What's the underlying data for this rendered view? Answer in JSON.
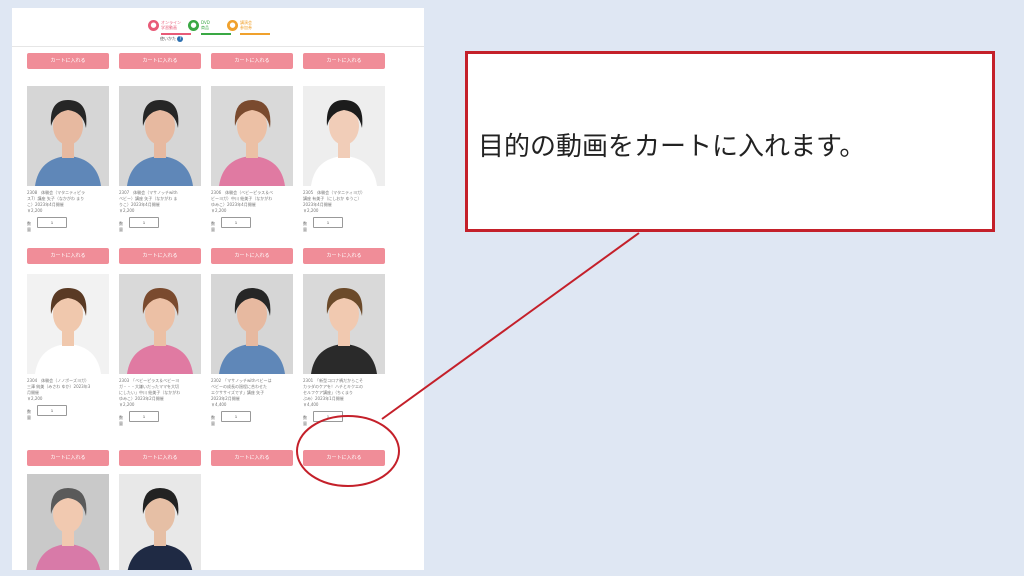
{
  "header": {
    "tabs": [
      {
        "label": "オンライン\n学習動画",
        "color": "#e85b78"
      },
      {
        "label": "DVD\n商品",
        "color": "#3aa844"
      },
      {
        "label": "講演会\n参加券",
        "color": "#f0a12d"
      }
    ],
    "sub_link": "使いかた",
    "help_icon": "?"
  },
  "cart_button_label": "カートに入れる",
  "qty_label": "数量",
  "qty_value": "1",
  "products": [
    {
      "caption": "2308　体験会（マタニティピラ\nス7）講座 矢子（なかがわ まり\nこ）2023年4月開催",
      "price": "￥2,200",
      "photo": {
        "bg": "#d6d6d6",
        "hair": "#262626",
        "skin": "#e7b9a0",
        "shirt": "#5f87b8"
      }
    },
    {
      "caption": "2307　体験会（マサノッチwith\nベビー）講座 矢子（なかがわ ま\nりこ）2023年4月開催",
      "price": "￥2,200",
      "photo": {
        "bg": "#d6d6d6",
        "hair": "#262626",
        "skin": "#e7b9a0",
        "shirt": "#5f87b8"
      }
    },
    {
      "caption": "2306　体験会（ベビーピラス＆ベ\nビーヨガ）中川 絵美子（なかがわ\nゆみこ）2023年4月開催",
      "price": "￥2,200",
      "photo": {
        "bg": "#d9d9d9",
        "hair": "#7a4a2e",
        "skin": "#ecc0a5",
        "shirt": "#e07aa2"
      }
    },
    {
      "caption": "2305　体験会（マタニティヨガ）\n講座 有美子（にしおか ゆうこ）\n2023年4月開催",
      "price": "￥2,200",
      "photo": {
        "bg": "#eeeeee",
        "hair": "#1c1c1c",
        "skin": "#f1cdb8",
        "shirt": "#ffffff"
      }
    },
    {
      "caption": "2304　体験会（ノノポーズヨガ）\n三澤 純美（みさわ ゆか）2023年3\n月開催",
      "price": "￥2,200",
      "photo": {
        "bg": "#f2f2f2",
        "hair": "#5a3a24",
        "skin": "#f0c8ad",
        "shirt": "#ffffff"
      }
    },
    {
      "caption": "2303　「ベビーピラス＆ベビーヨ\nガ・・・大嫌いだったママを大切\nにしたい」中川 絵美子（なかがわ\nゆみこ）2023年2月開催",
      "price": "￥2,200",
      "photo": {
        "bg": "#d9d9d9",
        "hair": "#7a4a2e",
        "skin": "#ecc0a5",
        "shirt": "#e07aa2"
      }
    },
    {
      "caption": "2302　「マサノッチwithベビーは\nベビーの成長の過程に合わせた\nエクササイズです」講座 矢子\n2023年2月開催",
      "price": "￥4,400",
      "photo": {
        "bg": "#d6d6d6",
        "hair": "#262626",
        "skin": "#e7b9a0",
        "shirt": "#5f87b8"
      }
    },
    {
      "caption": "2301　「新型コロナ禍だからこそ\nカラダのケアを！ハチとキクエの\nセルフケア講座」（ちくまり\nぶみ）2023年1月開催",
      "price": "￥4,400",
      "photo": {
        "bg": "#d9d9d9",
        "hair": "#6b4a2a",
        "skin": "#f1c9b0",
        "shirt": "#2a2a2a"
      }
    },
    {
      "caption": "",
      "price": "",
      "photo": {
        "bg": "#c9c9c9",
        "hair": "#5a5a5a",
        "skin": "#f1c9b0",
        "shirt": "#d87aa8"
      }
    },
    {
      "caption": "",
      "price": "",
      "photo": {
        "bg": "#e8e8e8",
        "hair": "#222222",
        "skin": "#e6bfa5",
        "shirt": "#1f2a44"
      }
    }
  ],
  "callout": {
    "text": "目的の動画をカートに入れます。",
    "border_color": "#c4202a"
  }
}
